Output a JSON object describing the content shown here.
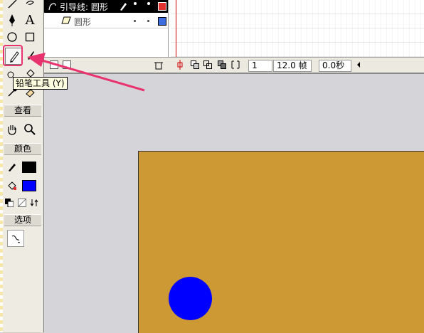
{
  "timeline": {
    "layer_guide_label": "引导线: 圆形",
    "layer_shape_label": "圆形",
    "frame_number": "1",
    "fps": "12.0 帧",
    "elapsed": "0.0秒"
  },
  "tools": {
    "view_title": "查看",
    "color_title": "颜色",
    "options_title": "选项",
    "text_tool_glyph": "A"
  },
  "tooltip": {
    "text": "铅笔工具 (Y)"
  },
  "colors": {
    "stage": "#cd9934",
    "circle": "#0000ff",
    "stroke_color": "#000000",
    "fill_color": "#0000ff",
    "highlight": "#e8336e"
  }
}
